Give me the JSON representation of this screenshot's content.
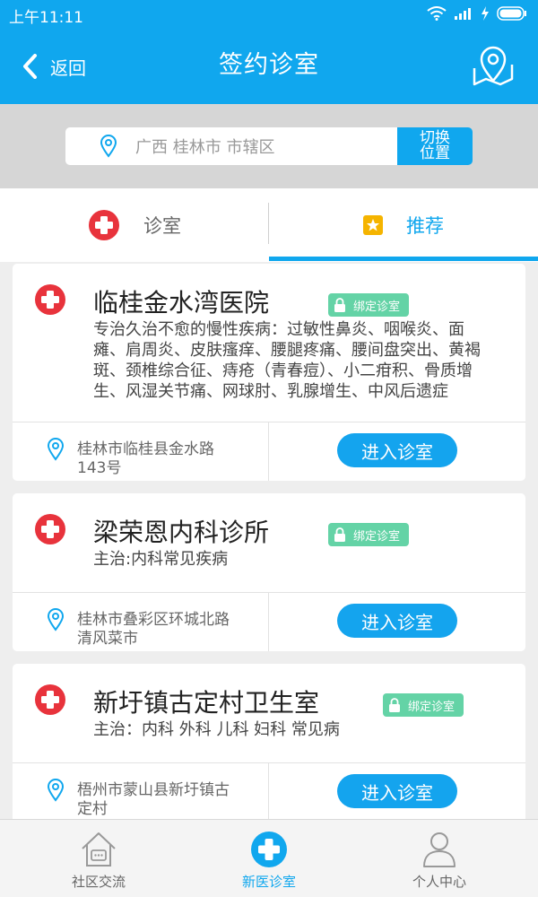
{
  "status_bar": {
    "time": "上午11:11"
  },
  "header": {
    "back_label": "返回",
    "title": "签约诊室"
  },
  "location": {
    "text": "广西 桂林市 市辖区",
    "switch_label_line1": "切换",
    "switch_label_line2": "位置"
  },
  "tabs": [
    {
      "label": "诊室",
      "active": false
    },
    {
      "label": "推荐",
      "active": true
    }
  ],
  "clinics": [
    {
      "name": "临桂金水湾医院",
      "badge": "绑定诊室",
      "desc_lines": [
        "专治久治不愈的慢性疾病：过敏性鼻炎、咽喉炎、面",
        "瘫、肩周炎、皮肤瘙痒、腰腿疼痛、腰间盘突出、黄褐",
        "斑、颈椎综合征、痔疮（青春痘）、小二疳积、骨质增",
        "生、风湿关节痛、网球肘、乳腺增生、中风后遗症"
      ],
      "address_lines": [
        "桂林市临桂县金水路",
        "143号"
      ],
      "enter_label": "进入诊室"
    },
    {
      "name": "梁荣恩内科诊所",
      "badge": "绑定诊室",
      "desc_lines": [
        "主治:内科常见疾病"
      ],
      "address_lines": [
        "桂林市叠彩区环城北路",
        "清风菜市"
      ],
      "enter_label": "进入诊室"
    },
    {
      "name": "新圩镇古定村卫生室",
      "badge": "绑定诊室",
      "desc_lines": [
        "主治：内科 外科 儿科 妇科 常见病"
      ],
      "address_lines": [
        "梧州市蒙山县新圩镇古",
        "定村"
      ],
      "enter_label": "进入诊室"
    }
  ],
  "bottom_nav": [
    {
      "label": "社区交流",
      "icon": "home-chat-icon",
      "active": false
    },
    {
      "label": "新医诊室",
      "icon": "medical-cross-icon",
      "active": true
    },
    {
      "label": "个人中心",
      "icon": "person-icon",
      "active": false
    }
  ],
  "colors": {
    "primary": "#10a7ee",
    "badge": "#64d3a6",
    "cross_red": "#e8333c",
    "star_yellow": "#f5b400"
  }
}
